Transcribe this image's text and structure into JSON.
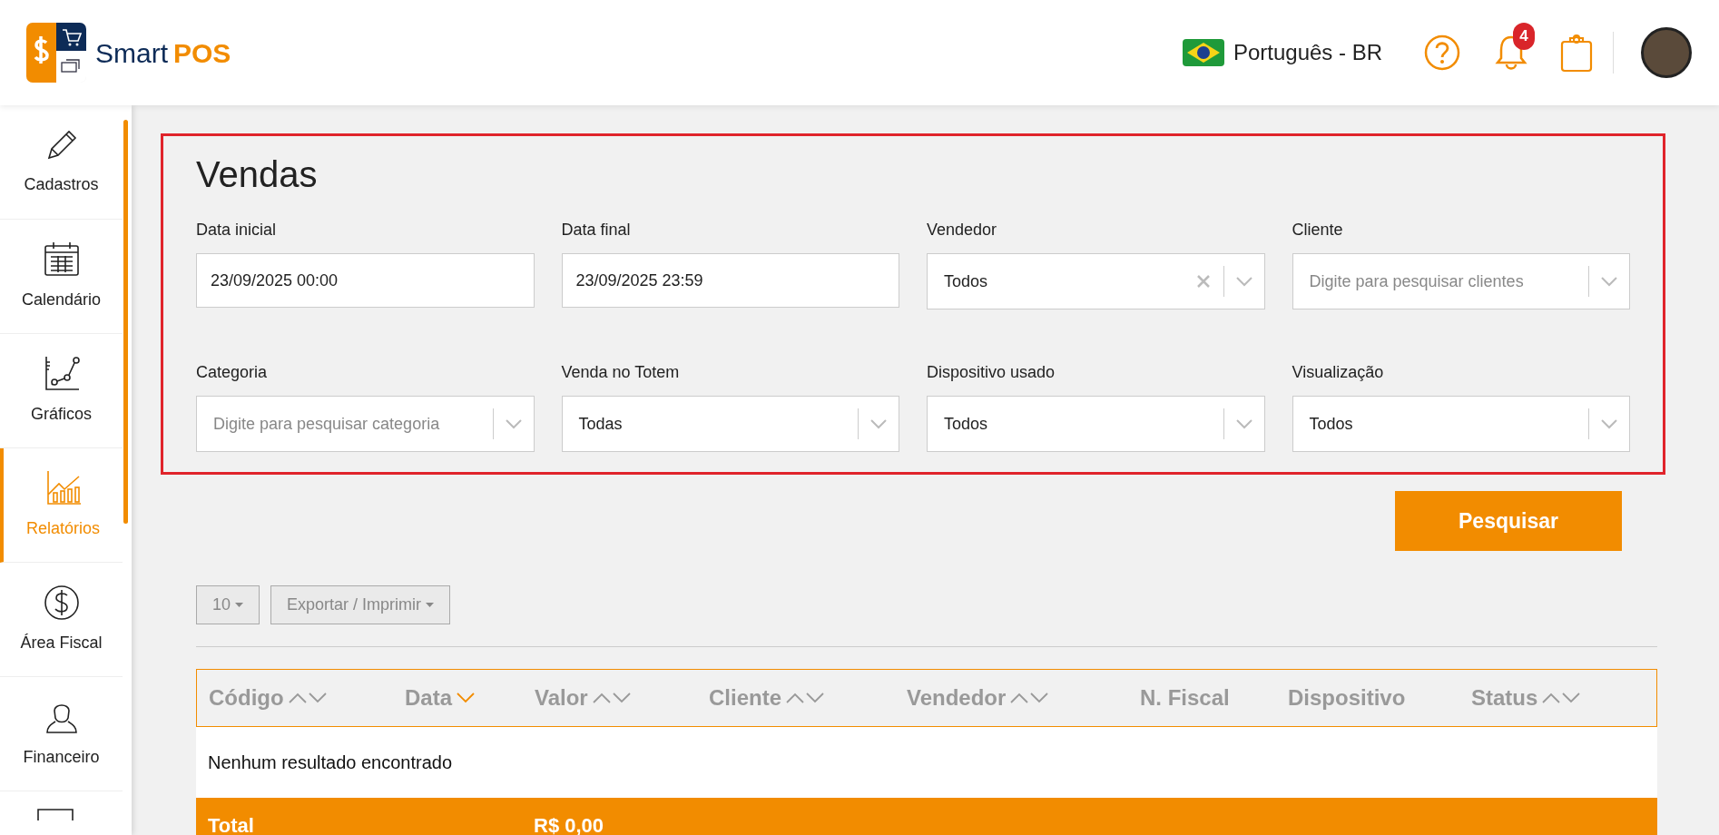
{
  "header": {
    "brand": {
      "name": "Smart",
      "accent": "POS"
    },
    "language": "Português - BR",
    "notifications": "4"
  },
  "sidebar": {
    "items": [
      {
        "label": "Cadastros",
        "selected": false
      },
      {
        "label": "Calendário",
        "selected": false
      },
      {
        "label": "Gráficos",
        "selected": false
      },
      {
        "label": "Relatórios",
        "selected": true
      },
      {
        "label": "Área Fiscal",
        "selected": false
      },
      {
        "label": "Financeiro",
        "selected": false
      }
    ]
  },
  "filters": {
    "title": "Vendas",
    "fields": [
      {
        "kind": "text",
        "label": "Data inicial",
        "value": "23/09/2025 00:00"
      },
      {
        "kind": "text",
        "label": "Data final",
        "value": "23/09/2025 23:59"
      },
      {
        "kind": "select",
        "label": "Vendedor",
        "value": "Todos",
        "clearable": true
      },
      {
        "kind": "select",
        "label": "Cliente",
        "placeholder": "Digite para pesquisar clientes",
        "clearable": false
      },
      {
        "kind": "select",
        "label": "Categoria",
        "placeholder": "Digite para pesquisar categoria",
        "clearable": false
      },
      {
        "kind": "select",
        "label": "Venda no Totem",
        "value": "Todas",
        "clearable": false
      },
      {
        "kind": "select",
        "label": "Dispositivo usado",
        "value": "Todos",
        "clearable": false
      },
      {
        "kind": "select",
        "label": "Visualização",
        "value": "Todos",
        "clearable": false
      }
    ]
  },
  "search_button": "Pesquisar",
  "toolbar": {
    "page_size": "10",
    "export": "Exportar / Imprimir"
  },
  "table": {
    "columns": [
      {
        "label": "Código",
        "sortable": true,
        "selected": false
      },
      {
        "label": "Data",
        "sortable": true,
        "selected": true
      },
      {
        "label": "Valor",
        "sortable": true,
        "selected": false
      },
      {
        "label": "Cliente",
        "sortable": true,
        "selected": false
      },
      {
        "label": "Vendedor",
        "sortable": true,
        "selected": false
      },
      {
        "label": "N. Fiscal",
        "sortable": false
      },
      {
        "label": "Dispositivo",
        "sortable": false
      },
      {
        "label": "Status",
        "sortable": true,
        "selected": false
      }
    ],
    "empty_message": "Nenhum resultado encontrado",
    "total": {
      "label": "Total",
      "value": "R$ 0,00"
    }
  }
}
